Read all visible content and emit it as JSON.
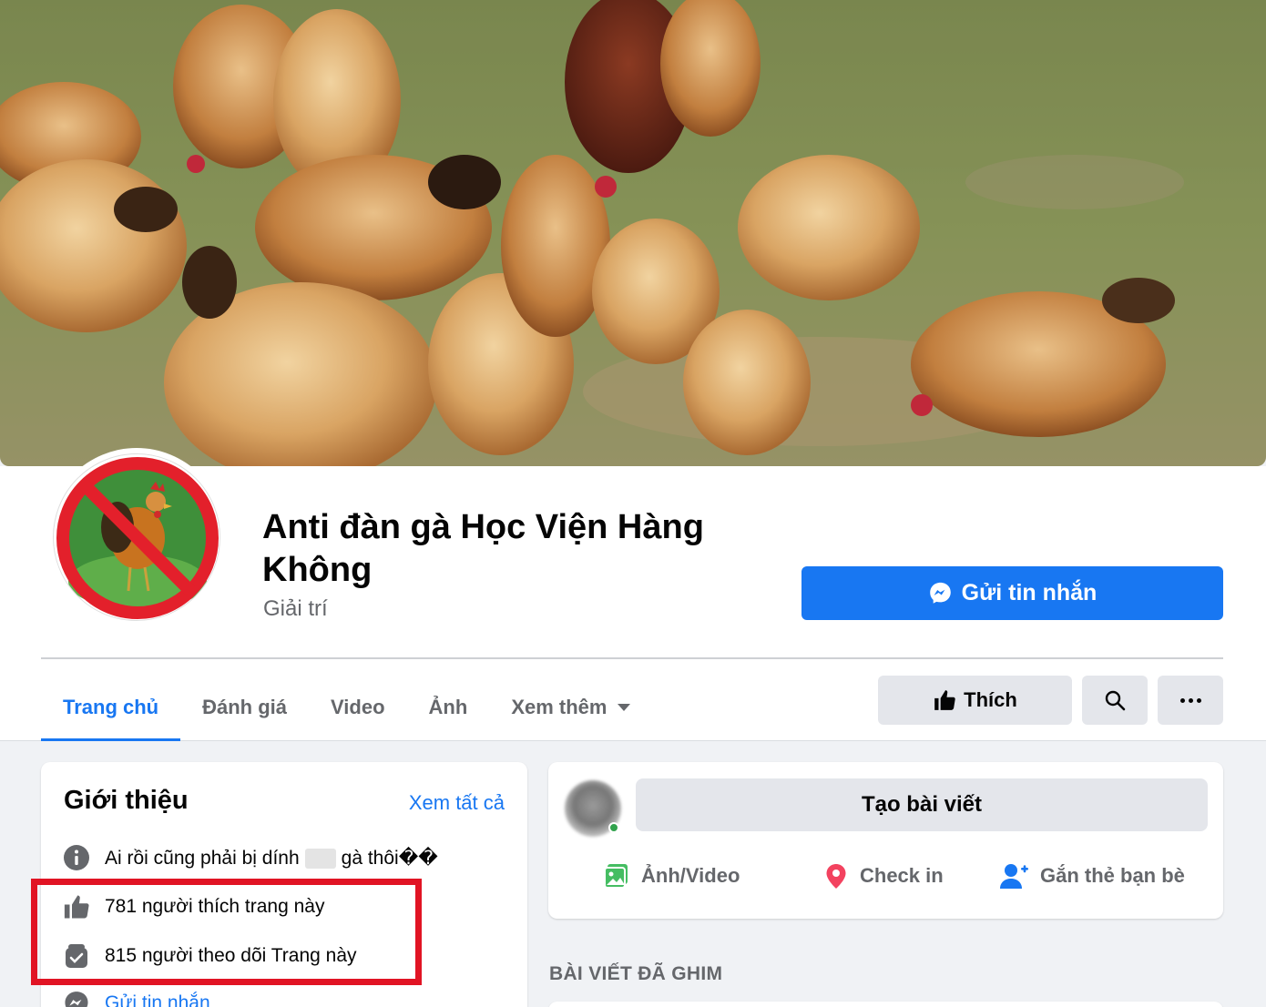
{
  "page": {
    "name": "Anti đàn gà Học Viện Hàng Không",
    "category": "Giải trí"
  },
  "actions": {
    "message_label": "Gửi tin nhắn",
    "like_label": "Thích"
  },
  "tabs": [
    {
      "label": "Trang chủ",
      "active": true
    },
    {
      "label": "Đánh giá",
      "active": false
    },
    {
      "label": "Video",
      "active": false
    },
    {
      "label": "Ảnh",
      "active": false
    },
    {
      "label": "Xem thêm",
      "active": false
    }
  ],
  "intro": {
    "title": "Giới thiệu",
    "see_all": "Xem tất cả",
    "description_before": "Ai rồi cũng phải bị dính",
    "description_after": "gà thôi��",
    "likes": "781 người thích trang này",
    "followers": "815 người theo dõi Trang này",
    "message_link": "Gửi tin nhắn"
  },
  "create_post": {
    "prompt": "Tạo bài viết",
    "actions": [
      {
        "label": "Ảnh/Video",
        "icon": "photo-video-icon",
        "color": "#45bd62"
      },
      {
        "label": "Check in",
        "icon": "location-pin-icon",
        "color": "#f3425f"
      },
      {
        "label": "Gắn thẻ bạn bè",
        "icon": "tag-friends-icon",
        "color": "#1877f2"
      }
    ]
  },
  "pinned": {
    "title": "BÀI VIẾT ĐÃ GHIM"
  },
  "colors": {
    "accent": "#1877f2",
    "highlight_frame": "#e11424",
    "background": "#f0f2f5"
  }
}
